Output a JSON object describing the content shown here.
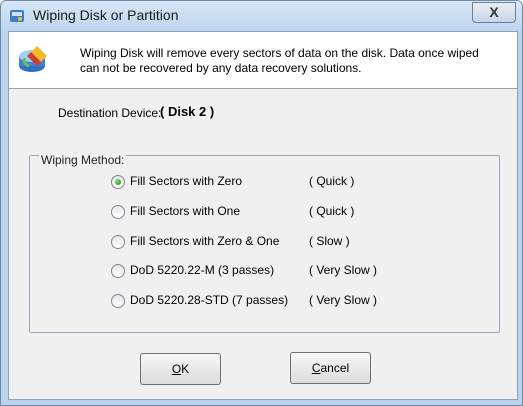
{
  "window": {
    "title": "Wiping Disk or Partition",
    "close_glyph": "X"
  },
  "header": {
    "icon": "disk-wipe-icon",
    "message": "Wiping Disk will remove every sectors of data on the disk. Data once wiped can not be recovered by any data recovery solutions."
  },
  "destination": {
    "label": "Destination Device:",
    "value": "( Disk 2 )"
  },
  "wiping_method": {
    "title": "Wiping Method:",
    "selected_index": 0,
    "options": [
      {
        "label": "Fill Sectors with Zero",
        "speed": "( Quick )"
      },
      {
        "label": "Fill Sectors with One",
        "speed": "( Quick )"
      },
      {
        "label": "Fill Sectors with Zero & One",
        "speed": "( Slow )"
      },
      {
        "label": "DoD 5220.22-M (3 passes)",
        "speed": "( Very Slow )"
      },
      {
        "label": "DoD 5220.28-STD (7 passes)",
        "speed": "( Very Slow )"
      }
    ]
  },
  "buttons": {
    "ok": {
      "first": "O",
      "rest": "K"
    },
    "cancel": {
      "first": "C",
      "rest": "ancel"
    }
  }
}
